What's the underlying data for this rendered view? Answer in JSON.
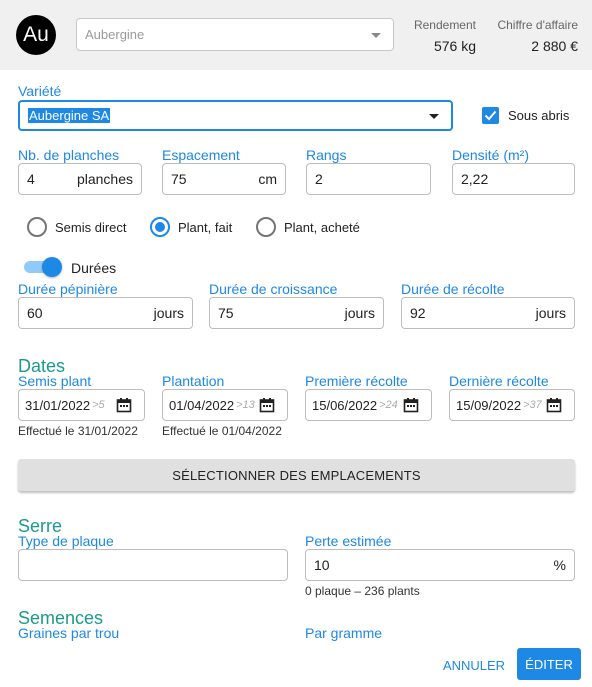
{
  "header": {
    "avatar_text": "Au",
    "crop_select_value": "Aubergine",
    "stats": [
      {
        "label": "Rendement",
        "value": "576 kg"
      },
      {
        "label": "Chiffre d'affaire",
        "value": "2 880 €"
      }
    ]
  },
  "variety": {
    "label": "Variété",
    "value": "Aubergine SA",
    "sous_abris_label": "Sous abris",
    "sous_abris_checked": true
  },
  "planches": {
    "nb_label": "Nb. de planches",
    "nb_value": "4",
    "nb_unit": "planches",
    "espacement_label": "Espacement",
    "espacement_value": "75",
    "espacement_unit": "cm",
    "rangs_label": "Rangs",
    "rangs_value": "2",
    "densite_label": "Densité (m²)",
    "densite_value": "2,22"
  },
  "method": {
    "options": [
      "Semis direct",
      "Plant, fait",
      "Plant, acheté"
    ],
    "selected": "Plant, fait"
  },
  "durees": {
    "toggle_label": "Durées",
    "toggle_on": true,
    "pepiniere_label": "Durée pépinière",
    "pepiniere_value": "60",
    "pepiniere_unit": "jours",
    "croissance_label": "Durée de croissance",
    "croissance_value": "75",
    "croissance_unit": "jours",
    "recolte_label": "Durée de récolte",
    "recolte_value": "92",
    "recolte_unit": "jours"
  },
  "dates": {
    "title": "Dates",
    "fields": [
      {
        "label": "Semis plant",
        "value": "31/01/2022",
        "hint": ">5",
        "note": "Effectué le 31/01/2022"
      },
      {
        "label": "Plantation",
        "value": "01/04/2022",
        "hint": ">13",
        "note": "Effectué le 01/04/2022"
      },
      {
        "label": "Première récolte",
        "value": "15/06/2022",
        "hint": ">24",
        "note": ""
      },
      {
        "label": "Dernière récolte",
        "value": "15/09/2022",
        "hint": ">37",
        "note": ""
      }
    ]
  },
  "emplacements_button": "SÉLECTIONNER DES EMPLACEMENTS",
  "serre": {
    "title": "Serre",
    "plaque_label": "Type de plaque",
    "plaque_value": "",
    "perte_label": "Perte estimée",
    "perte_value": "10",
    "perte_unit": "%",
    "perte_note": "0 plaque – 236 plants"
  },
  "semences": {
    "title": "Semences",
    "graines_label": "Graines par trou",
    "par_gramme_label": "Par gramme"
  },
  "actions": {
    "cancel": "ANNULER",
    "edit": "ÉDITER"
  },
  "colors": {
    "accent": "#1e88e5",
    "section_title": "#1a9a8a",
    "header_bg": "#f0f0f0"
  }
}
